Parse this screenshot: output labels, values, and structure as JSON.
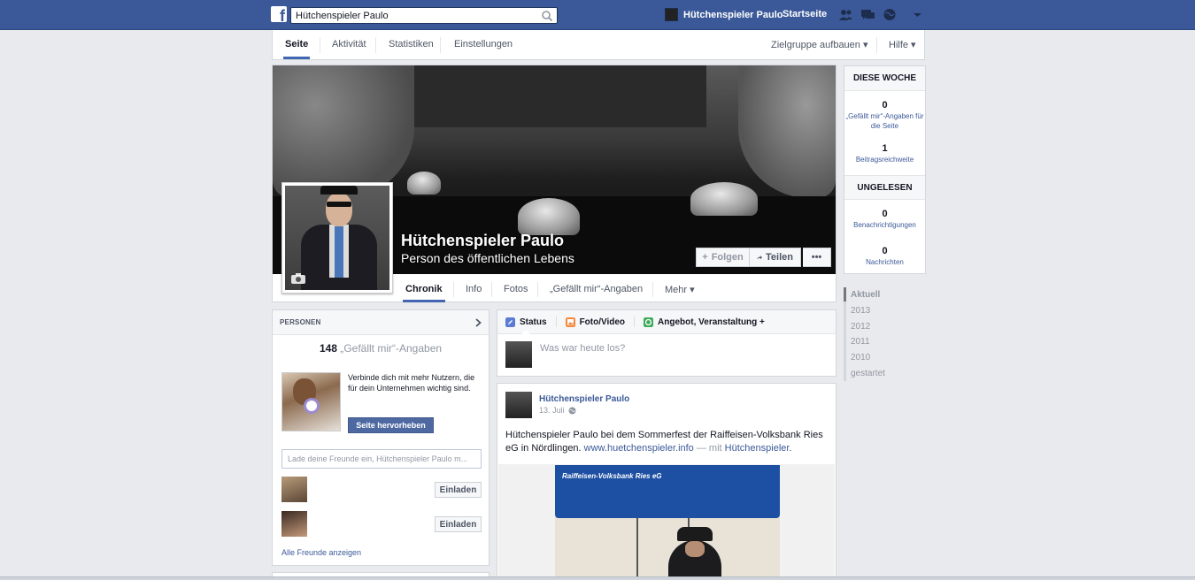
{
  "topbar": {
    "logo": "f",
    "search_value": "Hütchenspieler Paulo",
    "user_name": "Hütchenspieler Paulo",
    "home_label": "Startseite",
    "icons": [
      "friend-requests-icon",
      "messages-icon",
      "notifications-globe-icon",
      "account-menu-chevron-icon"
    ],
    "brand_color": "#3b5998"
  },
  "pagenav": {
    "tabs": [
      "Seite",
      "Aktivität",
      "Statistiken",
      "Einstellungen"
    ],
    "right": [
      "Zielgruppe aufbauen ▾",
      "Hilfe ▾"
    ]
  },
  "cover": {
    "name": "Hütchenspieler Paulo",
    "category": "Person des öffentlichen Lebens",
    "buttons": {
      "follow": "Folgen",
      "share": "Teilen",
      "more": "•••"
    },
    "tabs": [
      "Chronik",
      "Info",
      "Fotos",
      "„Gefällt mir“-Angaben",
      "Mehr ▾"
    ]
  },
  "stats": {
    "week_header": "DIESE WOCHE",
    "likes_count": "0",
    "likes_label": "„Gefällt mir“-Angaben für die Seite",
    "reach_count": "1",
    "reach_label": "Beitragsreichweite",
    "unread_header": "UNGELESEN",
    "notif_count": "0",
    "notif_label": "Benachrichtigungen",
    "msg_count": "0",
    "msg_label": "Nachrichten"
  },
  "years": [
    "Aktuell",
    "2013",
    "2012",
    "2011",
    "2010",
    "gestartet"
  ],
  "personen": {
    "header": "PERSONEN",
    "likes_count": "148",
    "likes_label": "„Gefällt mir“-Angaben",
    "promo_text": "Verbinde dich mit mehr Nutzern, die für dein Unternehmen wichtig sind.",
    "promo_button": "Seite hervorheben",
    "invite_placeholder": "Lade deine Freunde ein, Hütchenspieler Paulo m...",
    "invite_button": "Einladen",
    "all_friends": "Alle Freunde anzeigen"
  },
  "composer": {
    "tabs": [
      "Status",
      "Foto/Video",
      "Angebot, Veranstaltung +"
    ],
    "placeholder": "Was war heute los?"
  },
  "post": {
    "author": "Hütchenspieler Paulo",
    "date": "13. Juli",
    "text_start": "Hütchenspieler Paulo bei dem Sommerfest der Raiffeisen-Volksbank Ries eG in Nördlingen.",
    "link": "www.huetchenspieler.info",
    "mit": "— mit",
    "tagged": "Hütchenspieler.",
    "photo_caption": "Raiffeisen-Volksbank Ries eG"
  }
}
